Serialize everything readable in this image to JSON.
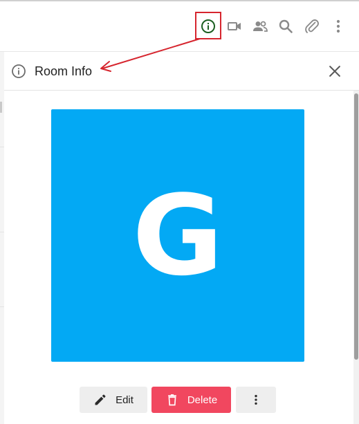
{
  "header": {
    "icons": [
      {
        "name": "info-icon",
        "color": "#1b5e20"
      },
      {
        "name": "video-call-icon",
        "color": "#8a8a8a"
      },
      {
        "name": "members-icon",
        "color": "#8a8a8a"
      },
      {
        "name": "search-icon",
        "color": "#8a8a8a"
      },
      {
        "name": "attachment-icon",
        "color": "#8a8a8a"
      },
      {
        "name": "kebab-menu-icon",
        "color": "#8a8a8a"
      }
    ],
    "highlight_color": "#d6252e"
  },
  "panel": {
    "title": "Room Info",
    "avatar": {
      "letter": "G",
      "background": "#03a9f4"
    },
    "actions": {
      "edit_label": "Edit",
      "delete_label": "Delete",
      "delete_color": "#f1475f"
    }
  },
  "annotation": {
    "arrow_color": "#d6252e"
  }
}
